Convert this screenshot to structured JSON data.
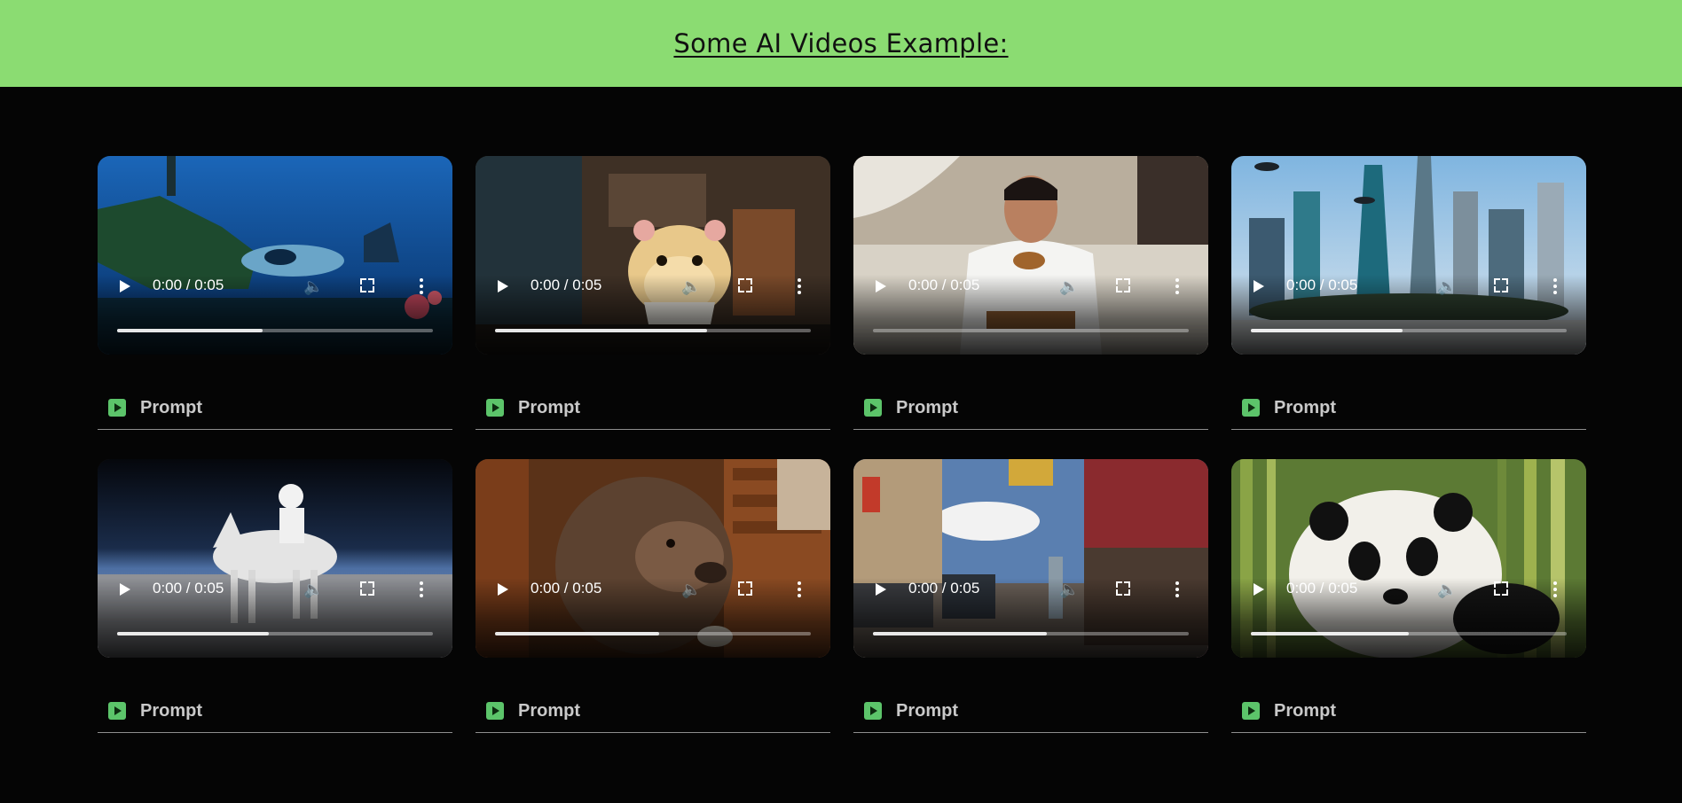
{
  "header": {
    "title": "Some AI Videos Example:"
  },
  "videos": [
    {
      "scene": "underwater-submarine",
      "time": "0:00 / 0:05",
      "progress": 0.46,
      "prompt_label": "Prompt"
    },
    {
      "scene": "hamster-cup",
      "time": "0:00 / 0:05",
      "progress": 0.67,
      "prompt_label": "Prompt"
    },
    {
      "scene": "man-eating-burger",
      "time": "0:00 / 0:05",
      "progress": 0.0,
      "prompt_label": "Prompt"
    },
    {
      "scene": "futuristic-city",
      "time": "0:00 / 0:05",
      "progress": 0.48,
      "prompt_label": "Prompt"
    },
    {
      "scene": "astronaut-horse",
      "time": "0:00 / 0:05",
      "progress": 0.48,
      "prompt_label": "Prompt"
    },
    {
      "scene": "bear-cabin",
      "time": "0:00 / 0:05",
      "progress": 0.52,
      "prompt_label": "Prompt"
    },
    {
      "scene": "retro-street",
      "time": "0:00 / 0:05",
      "progress": 0.55,
      "prompt_label": "Prompt"
    },
    {
      "scene": "panda-bamboo",
      "time": "0:00 / 0:05",
      "progress": 0.5,
      "prompt_label": "Prompt"
    }
  ]
}
